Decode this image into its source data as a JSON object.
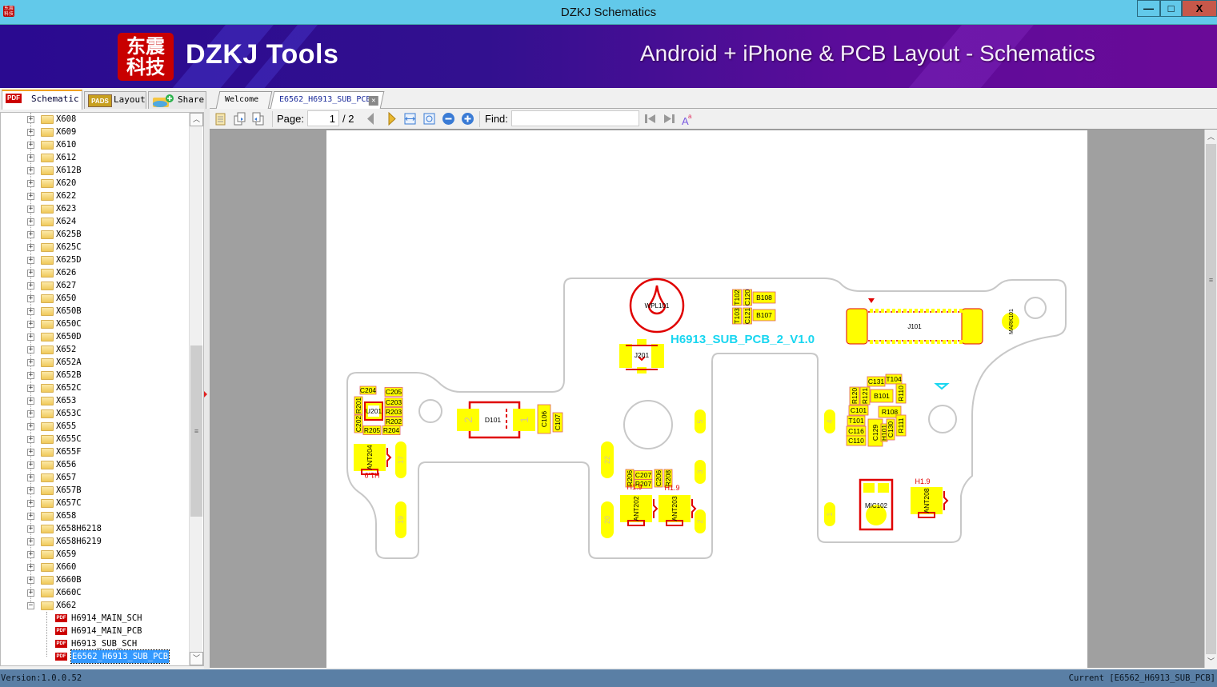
{
  "window": {
    "title": "DZKJ Schematics",
    "minimize": "—",
    "maximize": "□",
    "close": "X",
    "app_icon_text": "东震科技"
  },
  "banner": {
    "logo_text": "东震科技",
    "brand": "DZKJ Tools",
    "tagline": "Android + iPhone & PCB Layout - Schematics"
  },
  "left_tabs": [
    {
      "label": "Schematic",
      "icon": "PDF",
      "active": true
    },
    {
      "label": "Layout",
      "icon": "PADS",
      "active": false
    },
    {
      "label": "Share",
      "icon": "cloud-folder",
      "active": false
    }
  ],
  "doc_tabs": [
    {
      "label": "Welcome",
      "active": false
    },
    {
      "label": "E6562_H6913_SUB_PCB",
      "active": true,
      "close": "✕"
    }
  ],
  "tree": {
    "folders": [
      "X608",
      "X609",
      "X610",
      "X612",
      "X612B",
      "X620",
      "X622",
      "X623",
      "X624",
      "X625B",
      "X625C",
      "X625D",
      "X626",
      "X627",
      "X650",
      "X650B",
      "X650C",
      "X650D",
      "X652",
      "X652A",
      "X652B",
      "X652C",
      "X653",
      "X653C",
      "X655",
      "X655C",
      "X655F",
      "X656",
      "X657",
      "X657B",
      "X657C",
      "X658",
      "X658H6218",
      "X658H6219",
      "X659",
      "X660",
      "X660B",
      "X660C",
      "X662"
    ],
    "expanded_folder": "X662",
    "files": [
      "H6914_MAIN_SCH",
      "H6914_MAIN_PCB",
      "H6913_SUB_SCH",
      "E6562_H6913_SUB_PCB"
    ],
    "selected_file": "E6562_H6913_SUB_PCB"
  },
  "toolbar": {
    "page_label": "Page:",
    "page_value": "1",
    "page_total": "/ 2",
    "find_label": "Find:",
    "find_value": ""
  },
  "pcb": {
    "board_title": "H6913_SUB_PCB_2_V1.0",
    "components": [
      "C204",
      "C205",
      "C203",
      "R203",
      "R202",
      "R204",
      "R205",
      "R201",
      "C202",
      "U201",
      "D101",
      "C106",
      "C107",
      "ANT204",
      "WPL101",
      "J201",
      "T102",
      "C120",
      "B108",
      "T103",
      "C121",
      "B107",
      "J101",
      "MARK101",
      "C131",
      "T104",
      "R120",
      "R121",
      "B101",
      "R110",
      "C101",
      "R108",
      "T101",
      "C116",
      "C110",
      "C129",
      "H101",
      "C130",
      "R111",
      "R206",
      "C207",
      "R207",
      "C206",
      "R208",
      "ANT202",
      "ANT203",
      "MIC102",
      "ANT208"
    ],
    "pads": [
      "17",
      "19",
      "22",
      "20",
      "5",
      "3",
      "2",
      "4",
      "1"
    ],
    "d101_pins": [
      "2",
      "1"
    ],
    "height_labels": [
      "H1.9",
      "H1.9",
      "H1.9",
      "H1.9"
    ],
    "colors": {
      "pad": "#ffff00",
      "outline": "#e00000",
      "board": "#c8c8c8",
      "title": "#19d6f0"
    }
  },
  "status": {
    "version": "Version:1.0.0.52",
    "current": "Current [E6562_H6913_SUB_PCB]"
  }
}
